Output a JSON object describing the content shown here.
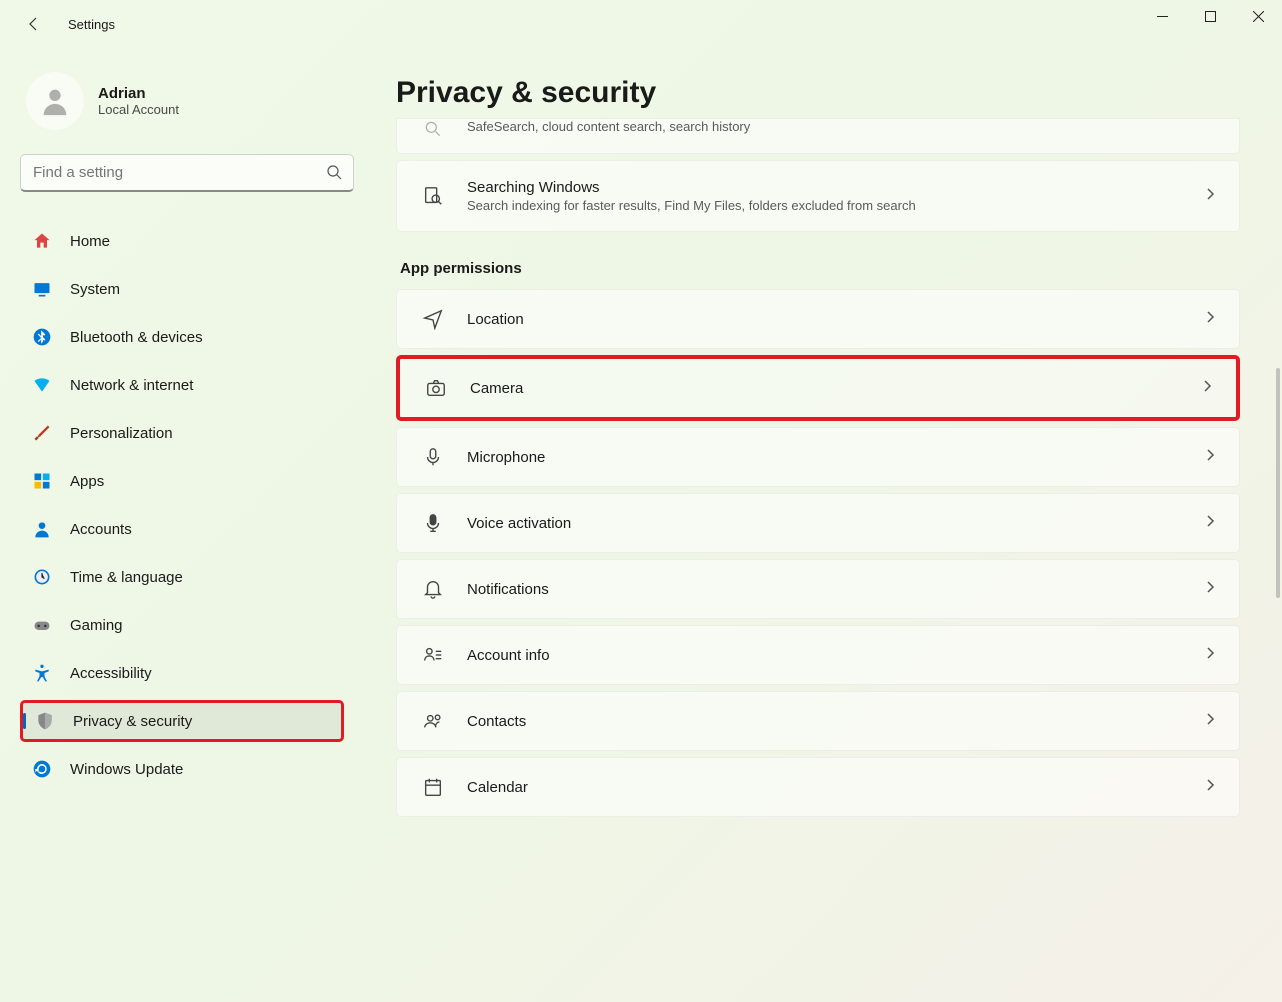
{
  "app_title": "Settings",
  "user": {
    "name": "Adrian",
    "sub": "Local Account"
  },
  "search": {
    "placeholder": "Find a setting"
  },
  "nav": [
    {
      "label": "Home",
      "icon": "home"
    },
    {
      "label": "System",
      "icon": "system"
    },
    {
      "label": "Bluetooth & devices",
      "icon": "bluetooth"
    },
    {
      "label": "Network & internet",
      "icon": "wifi"
    },
    {
      "label": "Personalization",
      "icon": "brush"
    },
    {
      "label": "Apps",
      "icon": "apps"
    },
    {
      "label": "Accounts",
      "icon": "accounts"
    },
    {
      "label": "Time & language",
      "icon": "time"
    },
    {
      "label": "Gaming",
      "icon": "gaming"
    },
    {
      "label": "Accessibility",
      "icon": "accessibility"
    },
    {
      "label": "Privacy & security",
      "icon": "shield",
      "active": true,
      "highlight": true
    },
    {
      "label": "Windows Update",
      "icon": "update"
    }
  ],
  "page": {
    "title": "Privacy & security"
  },
  "partial_row": {
    "sub": "SafeSearch, cloud content search, search history"
  },
  "top_cards": [
    {
      "title": "Searching Windows",
      "sub": "Search indexing for faster results, Find My Files, folders excluded from search",
      "icon": "search-doc"
    }
  ],
  "section_header": "App permissions",
  "perm_cards": [
    {
      "title": "Location",
      "icon": "location"
    },
    {
      "title": "Camera",
      "icon": "camera",
      "highlight": true
    },
    {
      "title": "Microphone",
      "icon": "microphone"
    },
    {
      "title": "Voice activation",
      "icon": "voice"
    },
    {
      "title": "Notifications",
      "icon": "bell"
    },
    {
      "title": "Account info",
      "icon": "account-info"
    },
    {
      "title": "Contacts",
      "icon": "contacts"
    },
    {
      "title": "Calendar",
      "icon": "calendar"
    }
  ]
}
